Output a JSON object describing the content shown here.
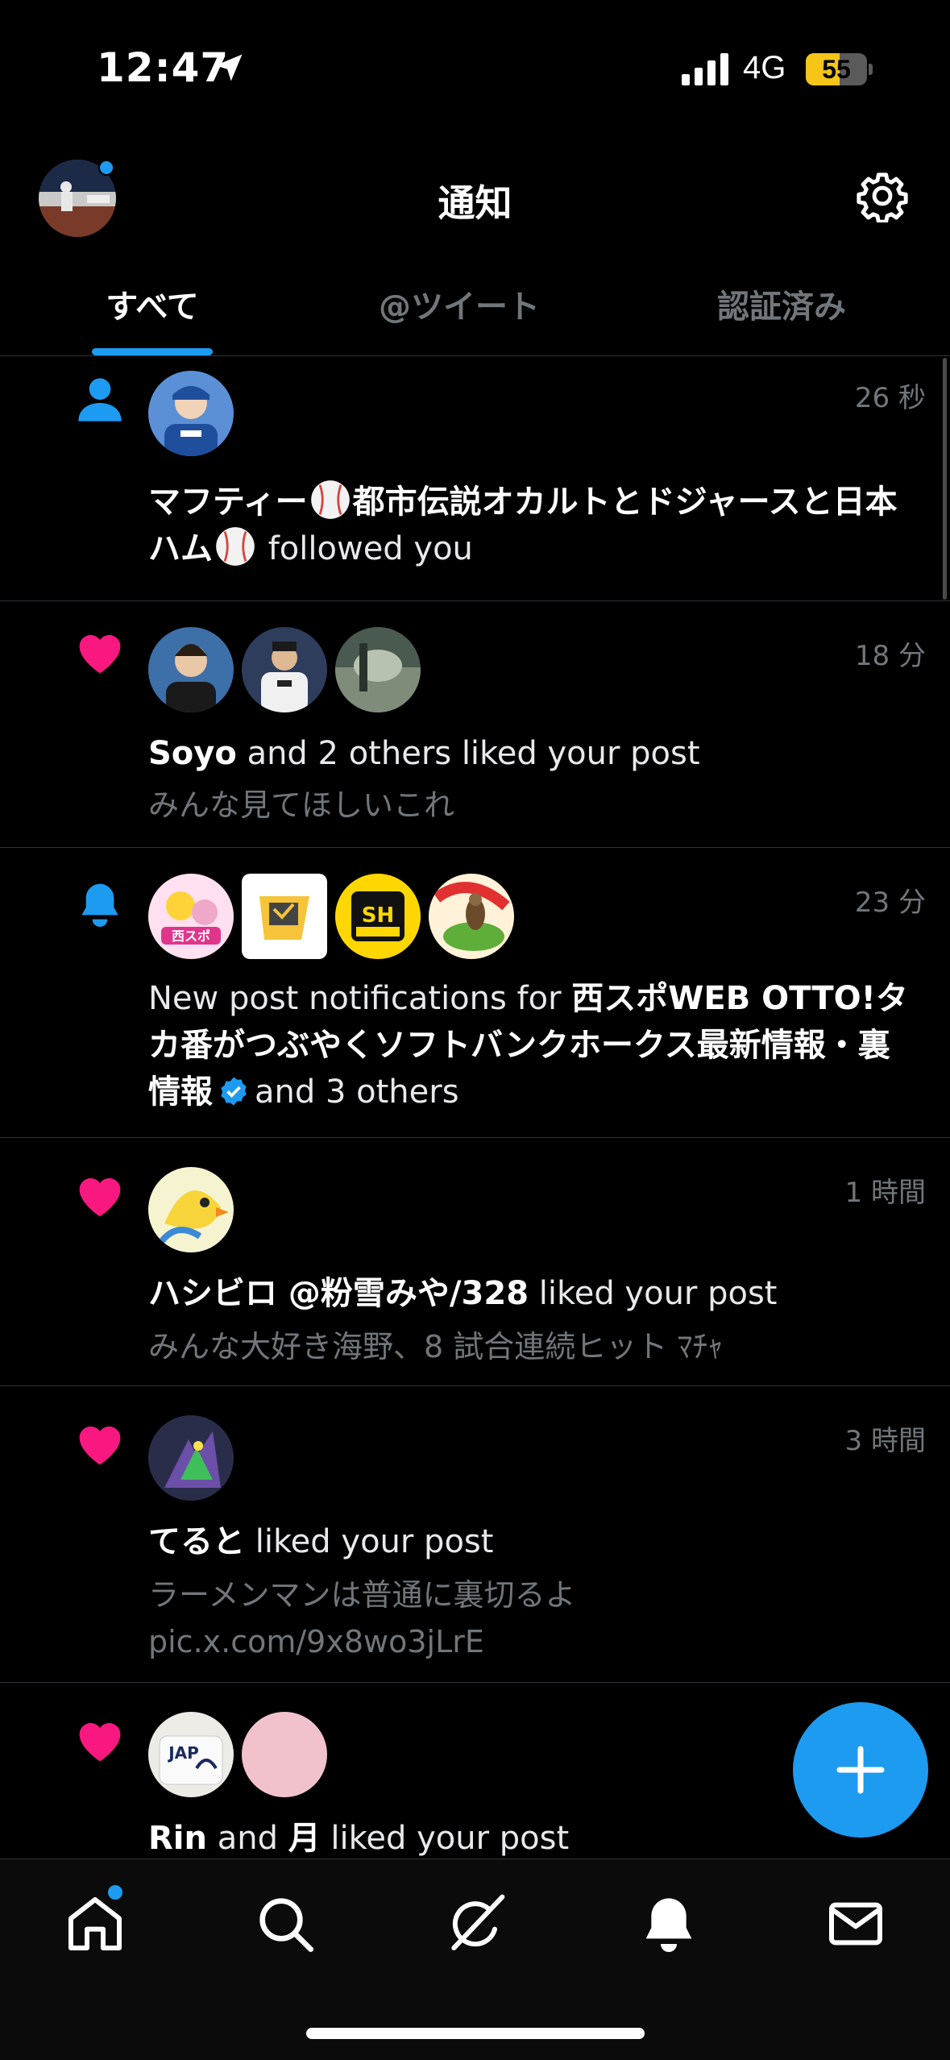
{
  "status_bar": {
    "time": "12:47",
    "network": "4G",
    "battery": "55",
    "battery_level": 0.55
  },
  "header": {
    "title": "通知"
  },
  "tabs": [
    {
      "label": "すべて",
      "active": true
    },
    {
      "label": "@ツイート",
      "active": false
    },
    {
      "label": "認証済み",
      "active": false
    }
  ],
  "notifications": [
    {
      "type": "follow",
      "time": "26 秒",
      "name_part1": "マフティー",
      "name_part2": "都市伝説オカルトとドジャースと日本ハム",
      "action": "followed you"
    },
    {
      "type": "like",
      "time": "18 分",
      "name": "Soyo",
      "action": "and 2 others liked your post",
      "snippet": "みんな見てほしいこれ"
    },
    {
      "type": "post_notification",
      "time": "23 分",
      "prefix": "New post notifications for",
      "name": "西スポWEB OTTO!タカ番がつぶやくソフトバンクホークス最新情報・裏情報",
      "suffix": "and 3 others"
    },
    {
      "type": "like",
      "time": "1 時間",
      "name": "ハシビロ @粉雪みや/328",
      "action": "liked your post",
      "snippet": "みんな大好き海野、8 試合連続ヒット ﾏﾁｬ"
    },
    {
      "type": "like",
      "time": "3 時間",
      "name": "てると",
      "action": "liked your post",
      "snippet": "ラーメンマンは普通に裏切るよ pic.x.com/9x8wo3jLrE"
    },
    {
      "type": "like",
      "time": "",
      "name1": "Rin",
      "and": "and",
      "name2": "月",
      "action": "liked your post"
    }
  ],
  "colors": {
    "accent": "#1d9bf0",
    "like": "#f91880",
    "muted": "#71767b",
    "divider": "#2f3336"
  }
}
